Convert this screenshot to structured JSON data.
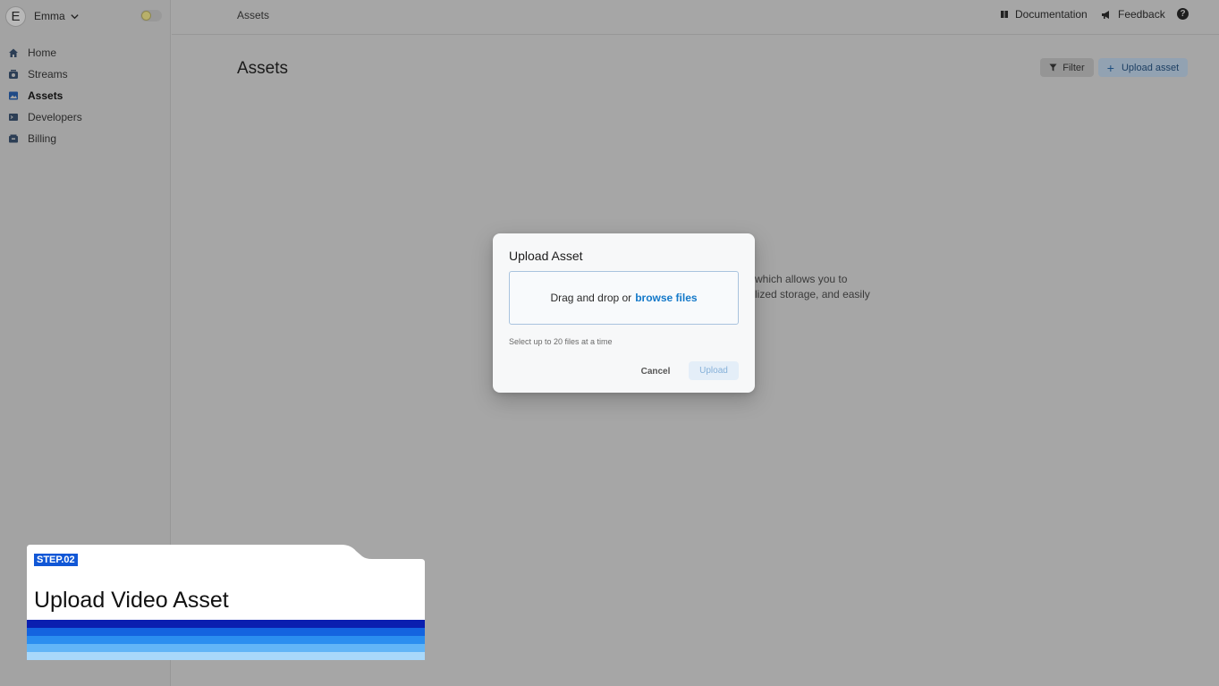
{
  "user": {
    "initial": "E",
    "name": "Emma",
    "icons": [
      "chevron-down-icon",
      "theme-toggle"
    ]
  },
  "sidebar": {
    "items": [
      {
        "label": "Home",
        "icon": "home-icon",
        "active": false
      },
      {
        "label": "Streams",
        "icon": "streams-icon",
        "active": false
      },
      {
        "label": "Assets",
        "icon": "assets-icon",
        "active": true
      },
      {
        "label": "Developers",
        "icon": "terminal-icon",
        "active": false
      },
      {
        "label": "Billing",
        "icon": "billing-icon",
        "active": false
      }
    ]
  },
  "header": {
    "breadcrumb": "Assets",
    "documentation_label": "Documentation",
    "feedback_label": "Feedback",
    "help_symbol": "?"
  },
  "main": {
    "title": "Assets",
    "filter_label": "Filter",
    "upload_label": "Upload asset",
    "background_text_line1": "which allows you to",
    "background_text_line2": "lized storage, and easily"
  },
  "modal": {
    "title": "Upload Asset",
    "drop_text": "Drag and drop or",
    "browse_label": "browse files",
    "hint": "Select up to 20 files at a time",
    "cancel_label": "Cancel",
    "upload_label": "Upload"
  },
  "step": {
    "badge": "STEP.02",
    "title": "Upload Video Asset",
    "stripe_colors": [
      "#0a1fb0",
      "#1464e0",
      "#2b8ef0",
      "#62b5f7",
      "#a9d8fa"
    ]
  }
}
